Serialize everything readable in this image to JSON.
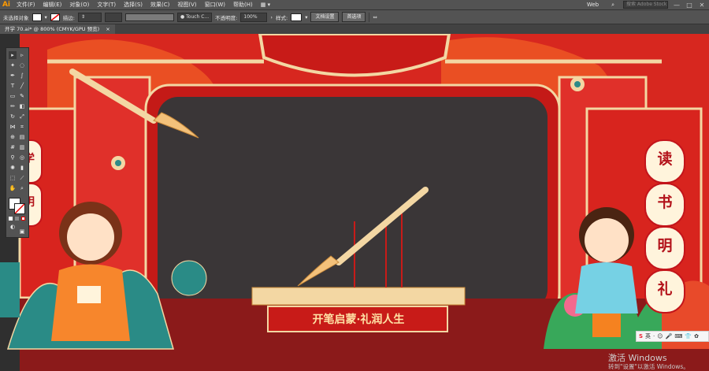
{
  "app": {
    "logo": "Ai"
  },
  "menu": [
    "文件(F)",
    "编辑(E)",
    "对象(O)",
    "文字(T)",
    "选择(S)",
    "效果(C)",
    "视图(V)",
    "窗口(W)",
    "帮助(H)"
  ],
  "menu_right": {
    "workspace": "Web",
    "search_placeholder": "搜索 Adobe Stock",
    "min": "—",
    "max": "□",
    "close": "✕"
  },
  "control_bar": {
    "selection_label": "未选择对象",
    "stroke_label": "描边:",
    "brush_dropdown": "Touch C...",
    "opacity_label": "不透明度:",
    "opacity_value": "100%",
    "style_label": "样式:",
    "doc_settings_button": "文档设置",
    "preferences_button": "首选项"
  },
  "document_tab": {
    "label": "开学 70.ai* @ 800% (CMYK/GPU 预览)",
    "close": "×"
  },
  "artwork": {
    "right_plaque": [
      "读",
      "书",
      "明",
      "礼"
    ],
    "left_plaque": [
      "学",
      "明"
    ],
    "banner_text": "开笔启蒙·礼润人生",
    "colors": {
      "red": "#d8241e",
      "dark_red": "#8b1a1a",
      "cream": "#f3d7a3",
      "screen": "#3a3637"
    }
  },
  "ime": {
    "logo": "S",
    "items": [
      "英",
      "·",
      "☺",
      "🎤",
      "⌨",
      "👕",
      "✿"
    ]
  },
  "watermark": {
    "title": "激活 Windows",
    "subtitle": "转到\"设置\"以激活 Windows。"
  }
}
